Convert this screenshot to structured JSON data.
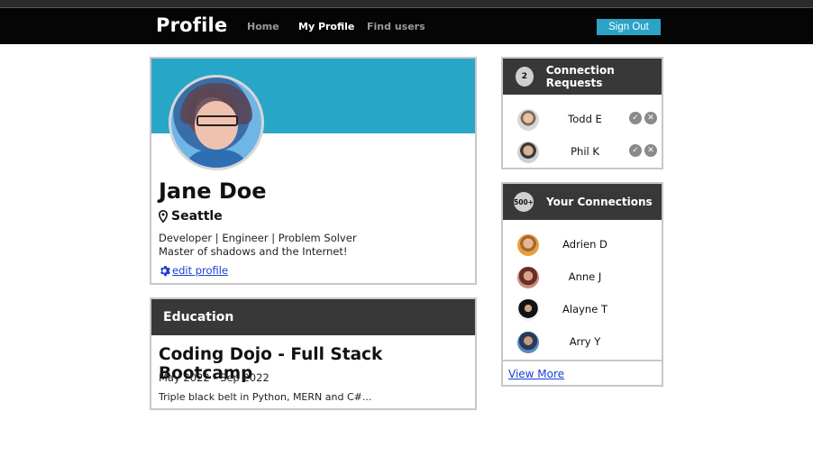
{
  "navbar": {
    "brand": "Profile",
    "links": [
      "Home",
      "My Profile",
      "Find users"
    ],
    "sign_out": "Sign Out"
  },
  "profile": {
    "name": "Jane Doe",
    "location": "Seattle",
    "bio_line1": "Developer | Engineer | Problem Solver",
    "bio_line2": "Master of shadows and the Internet!",
    "edit_label": " edit profile"
  },
  "education": {
    "heading": "Education",
    "school": "Coding Dojo - Full Stack Bootcamp",
    "dates": "May 2022 - Sep 2022",
    "description": "Triple black belt in Python, MERN and C#..."
  },
  "requests": {
    "count": "2",
    "heading": "Connection Requests",
    "people": [
      {
        "name": "Todd E"
      },
      {
        "name": "Phil K"
      }
    ]
  },
  "connections": {
    "count": "500+",
    "heading": "Your Connections",
    "people": [
      {
        "name": "Adrien D"
      },
      {
        "name": "Anne J"
      },
      {
        "name": "Alayne T"
      },
      {
        "name": "Arry Y"
      }
    ],
    "view_more": "View More"
  },
  "colors": {
    "banner": "#28a6c8",
    "sign_out_button": "#2aa3c6",
    "navbar": "#050505",
    "section_header": "#383838",
    "link": "#1a3fd6"
  }
}
